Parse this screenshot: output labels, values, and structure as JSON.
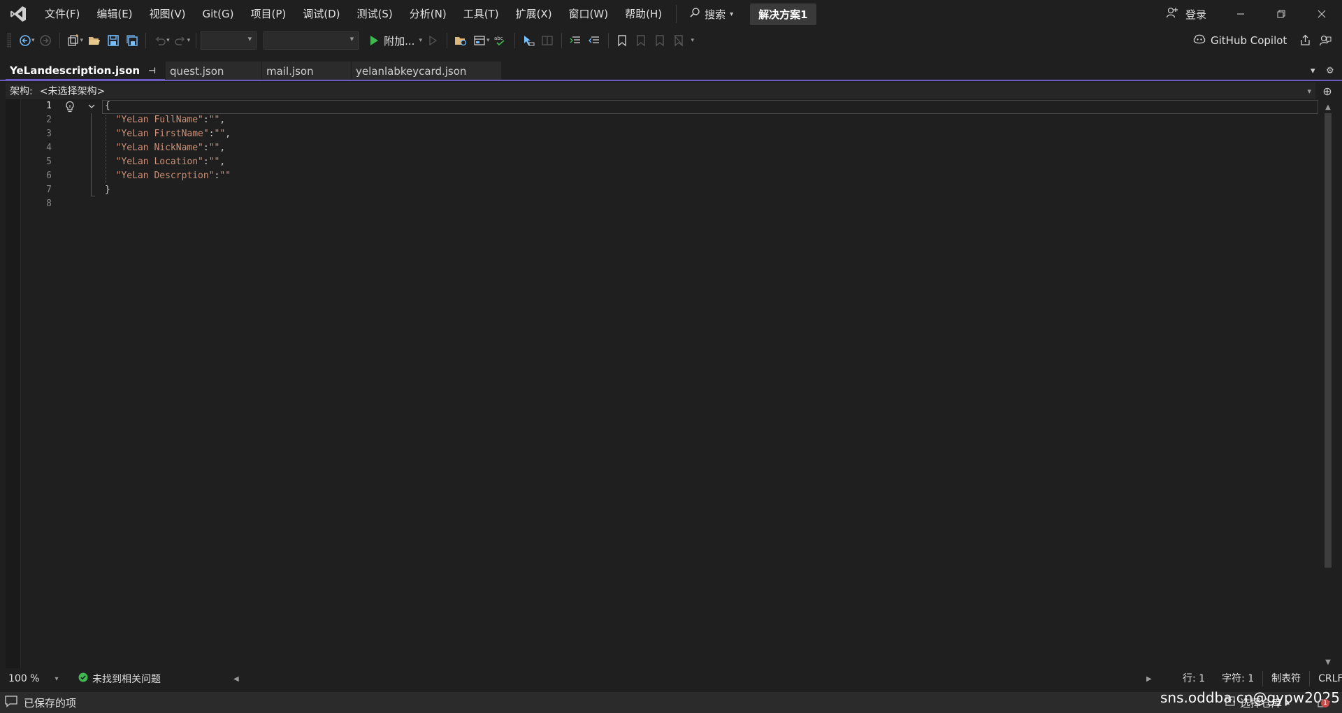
{
  "menu": [
    "文件(F)",
    "编辑(E)",
    "视图(V)",
    "Git(G)",
    "项目(P)",
    "调试(D)",
    "测试(S)",
    "分析(N)",
    "工具(T)",
    "扩展(X)",
    "窗口(W)",
    "帮助(H)"
  ],
  "search_label": "搜索",
  "solution_name": "解决方案1",
  "login_label": "登录",
  "toolbar": {
    "run_label": "附加..."
  },
  "copilot_label": "GitHub Copilot",
  "tabs": [
    {
      "label": "YeLandescription.json",
      "active": true
    },
    {
      "label": "quest.json"
    },
    {
      "label": "mail.json"
    },
    {
      "label": "yelanlabkeycard.json"
    }
  ],
  "schema": {
    "label": "架构:",
    "value": "<未选择架构>"
  },
  "editor": {
    "line_numbers": [
      "1",
      "2",
      "3",
      "4",
      "5",
      "6",
      "7",
      "8"
    ],
    "current_line": 1,
    "keys": [
      "\"YeLan FullName\"",
      "\"YeLan FirstName\"",
      "\"YeLan NickName\"",
      "\"YeLan Location\"",
      "\"YeLan Descrption\""
    ],
    "empty_value": "\"\""
  },
  "editor_bar": {
    "zoom": "100 %",
    "issues": "未找到相关问题",
    "line": "行: 1",
    "char": "字符: 1",
    "tabs_mode": "制表符",
    "eol": "CRLF"
  },
  "status": {
    "saved": "已保存的项",
    "source_control": "选择仓库",
    "notifications": "1"
  },
  "watermark": "sns.oddba.cn@gypw2025",
  "colors": {
    "accent": "#6b5bbf",
    "run_green": "#3fb950",
    "string": "#ce9178",
    "key": "#d7ba7d"
  }
}
